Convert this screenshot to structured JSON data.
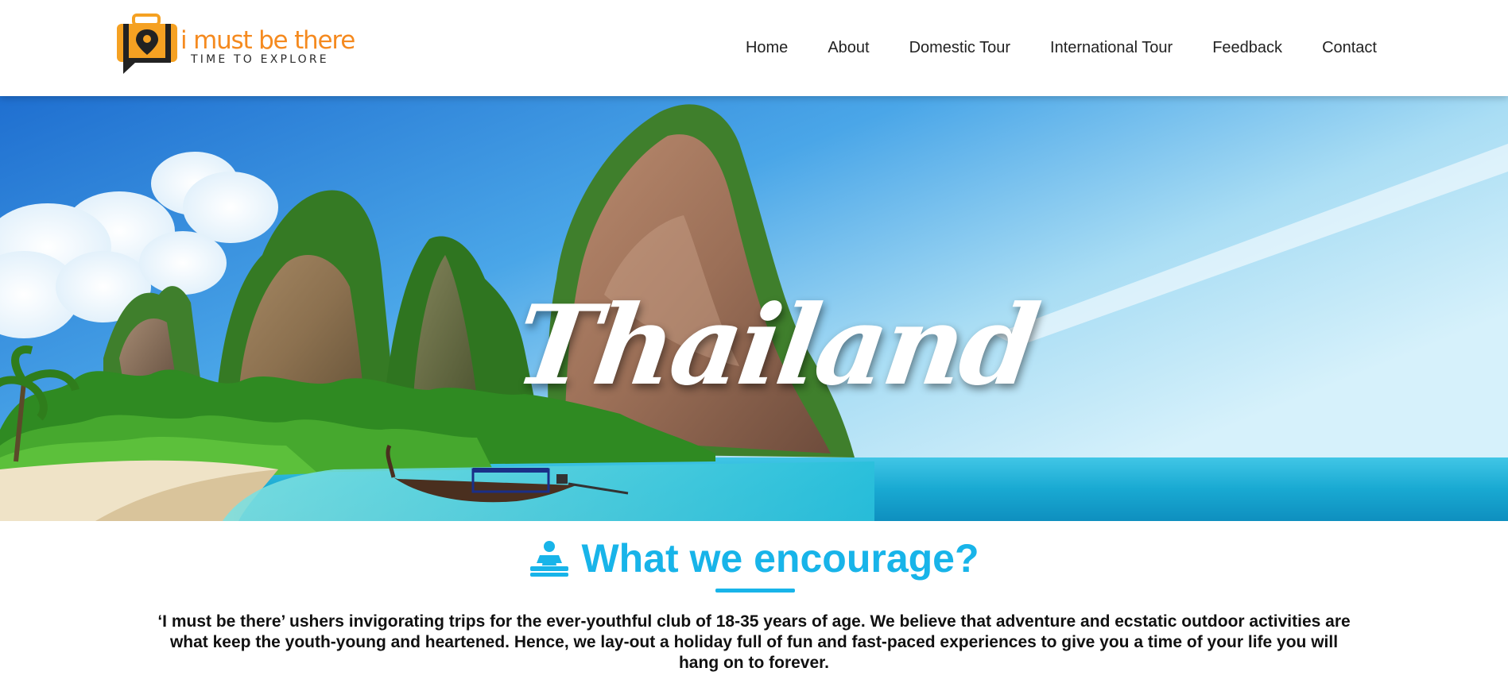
{
  "header": {
    "logo": {
      "title": "i must be there",
      "tagline": "TIME TO EXPLORE",
      "icon": "luggage-location-pin-logo",
      "colors": {
        "orange": "#f5a122",
        "dark": "#222222"
      }
    },
    "nav": [
      {
        "label": "Home"
      },
      {
        "label": "About"
      },
      {
        "label": "Domestic Tour"
      },
      {
        "label": "International Tour"
      },
      {
        "label": "Feedback"
      },
      {
        "label": "Contact"
      }
    ]
  },
  "hero": {
    "title": "Thailand",
    "image": "tropical-beach-limestone-cliffs-longtail-boat"
  },
  "encourage": {
    "icon": "person-meditation-icon",
    "title": "What we encourage?",
    "text": "‘I must be there’ ushers invigorating trips for the ever-youthful club of 18-35 years of age. We believe that adventure and ecstatic outdoor activities are what keep the youth-young and heartened. Hence, we lay-out a holiday full of fun and fast-paced experiences to give you a time of your life you will hang on to forever.",
    "accent_color": "#18b4e9"
  }
}
